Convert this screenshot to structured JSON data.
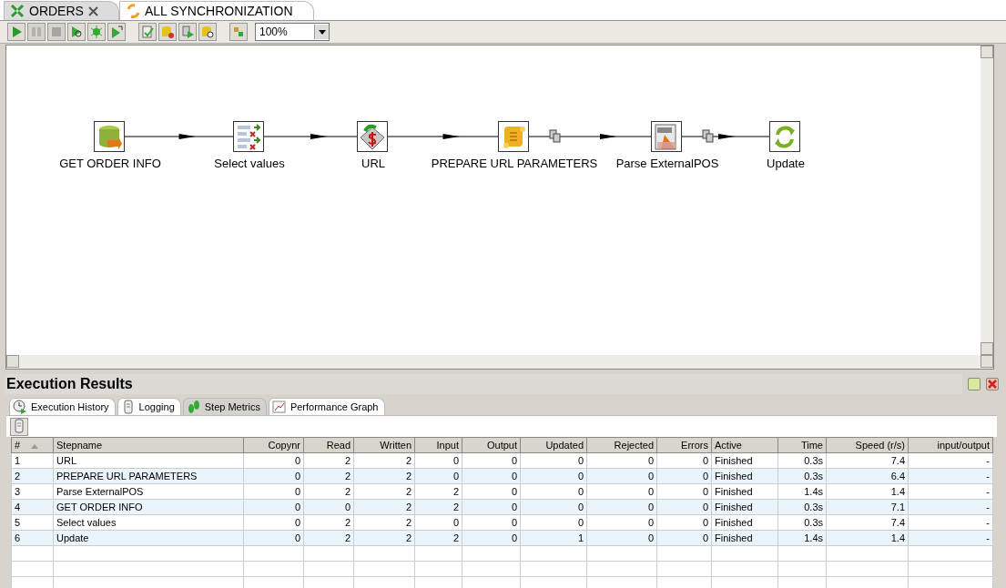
{
  "editor_tabs": [
    {
      "label": "ORDERS",
      "kind": "transformation",
      "selected": true,
      "closable": true
    },
    {
      "label": "ALL SYNCHRONIZATION",
      "kind": "job",
      "selected": false,
      "closable": false
    }
  ],
  "toolbar": [
    {
      "kind": "run",
      "disabled": false
    },
    {
      "kind": "pause",
      "disabled": true
    },
    {
      "kind": "stop",
      "disabled": true
    },
    {
      "kind": "preview",
      "disabled": false
    },
    {
      "kind": "debug",
      "disabled": false
    },
    {
      "kind": "replay",
      "disabled": false
    },
    {
      "kind": "sep"
    },
    {
      "kind": "verify",
      "disabled": false
    },
    {
      "kind": "impact",
      "disabled": false
    },
    {
      "kind": "sql",
      "disabled": false
    },
    {
      "kind": "explore",
      "disabled": false
    },
    {
      "kind": "sep"
    },
    {
      "kind": "grid",
      "disabled": false
    }
  ],
  "zoom": {
    "value": "100%"
  },
  "canvas": {
    "steps": [
      {
        "label": "GET ORDER INFO",
        "kind": "table-input"
      },
      {
        "label": "Select values",
        "kind": "select"
      },
      {
        "label": "URL",
        "kind": "http"
      },
      {
        "label": "PREPARE URL PARAMETERS",
        "kind": "script"
      },
      {
        "label": "Parse ExternalPOS",
        "kind": "xml"
      },
      {
        "label": "Update",
        "kind": "update"
      }
    ],
    "hops": [
      {
        "copy": false
      },
      {
        "copy": false
      },
      {
        "copy": false
      },
      {
        "copy": true
      },
      {
        "copy": true
      }
    ]
  },
  "results": {
    "title": "Execution Results",
    "tabs": [
      {
        "label": "Execution History",
        "kind": "history",
        "selected": false
      },
      {
        "label": "Logging",
        "kind": "log",
        "selected": false
      },
      {
        "label": "Step Metrics",
        "kind": "metrics",
        "selected": true
      },
      {
        "label": "Performance Graph",
        "kind": "graph",
        "selected": false
      }
    ],
    "table": {
      "columns": [
        {
          "label": "#",
          "sorted": true
        },
        {
          "label": "Stepname",
          "sorted": false
        },
        {
          "label": "Copynr",
          "sorted": false
        },
        {
          "label": "Read",
          "sorted": false
        },
        {
          "label": "Written",
          "sorted": false
        },
        {
          "label": "Input",
          "sorted": false
        },
        {
          "label": "Output",
          "sorted": false
        },
        {
          "label": "Updated",
          "sorted": false
        },
        {
          "label": "Rejected",
          "sorted": false
        },
        {
          "label": "Errors",
          "sorted": false
        },
        {
          "label": "Active",
          "sorted": false
        },
        {
          "label": "Time",
          "sorted": false
        },
        {
          "label": "Speed (r/s)",
          "sorted": false
        },
        {
          "label": "input/output",
          "sorted": false
        }
      ],
      "rows": [
        [
          "1",
          "URL",
          "0",
          "2",
          "2",
          "0",
          "0",
          "0",
          "0",
          "0",
          "Finished",
          "0.3s",
          "7.4",
          "-"
        ],
        [
          "2",
          "PREPARE URL PARAMETERS",
          "0",
          "2",
          "2",
          "0",
          "0",
          "0",
          "0",
          "0",
          "Finished",
          "0.3s",
          "6.4",
          "-"
        ],
        [
          "3",
          "Parse ExternalPOS",
          "0",
          "2",
          "2",
          "2",
          "0",
          "0",
          "0",
          "0",
          "Finished",
          "1.4s",
          "1.4",
          "-"
        ],
        [
          "4",
          "GET ORDER INFO",
          "0",
          "0",
          "2",
          "2",
          "0",
          "0",
          "0",
          "0",
          "Finished",
          "0.3s",
          "7.1",
          "-"
        ],
        [
          "5",
          "Select values",
          "0",
          "2",
          "2",
          "0",
          "0",
          "0",
          "0",
          "0",
          "Finished",
          "0.3s",
          "7.4",
          "-"
        ],
        [
          "6",
          "Update",
          "0",
          "2",
          "2",
          "2",
          "0",
          "1",
          "0",
          "0",
          "Finished",
          "1.4s",
          "1.4",
          "-"
        ]
      ]
    }
  }
}
